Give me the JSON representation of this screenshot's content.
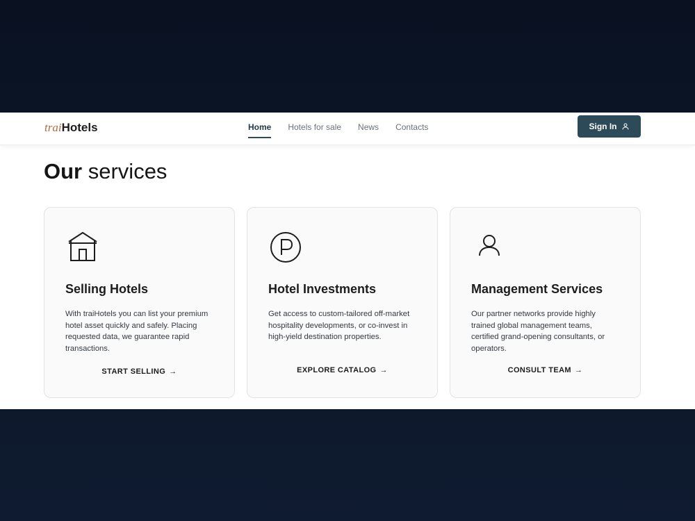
{
  "navbar": {
    "logo_light": "trai",
    "logo_bold": "Hotels",
    "nav_items": [
      "Home",
      "Hotels for sale",
      "News",
      "Contacts"
    ],
    "active_item": "Home",
    "signin_label": "Sign In"
  },
  "section": {
    "title_bold": "Our",
    "title_light": " services"
  },
  "cards": [
    {
      "icon": "house-icon",
      "title": "Selling Hotels",
      "description": "With traiHotels you can list your premium hotel asset quickly and safely. Placing requested data, we guarantee rapid transactions.",
      "link": "START SELLING"
    },
    {
      "icon": "parking-p-icon",
      "title": "Hotel Investments",
      "description": "Get access to custom-tailored off-market hospitality developments, or co-invest in high-yield destination properties.",
      "link": "EXPLORE CATALOG"
    },
    {
      "icon": "person-icon",
      "title": "Management Services",
      "description": "Our partner networks provide highly trained global management teams, certified grand-opening consultants, or operators.",
      "link": "CONSULT TEAM"
    }
  ],
  "colors": {
    "accent": "#2d4a59",
    "logo_accent": "#b36a3c",
    "background_dark": "#0c1628"
  }
}
